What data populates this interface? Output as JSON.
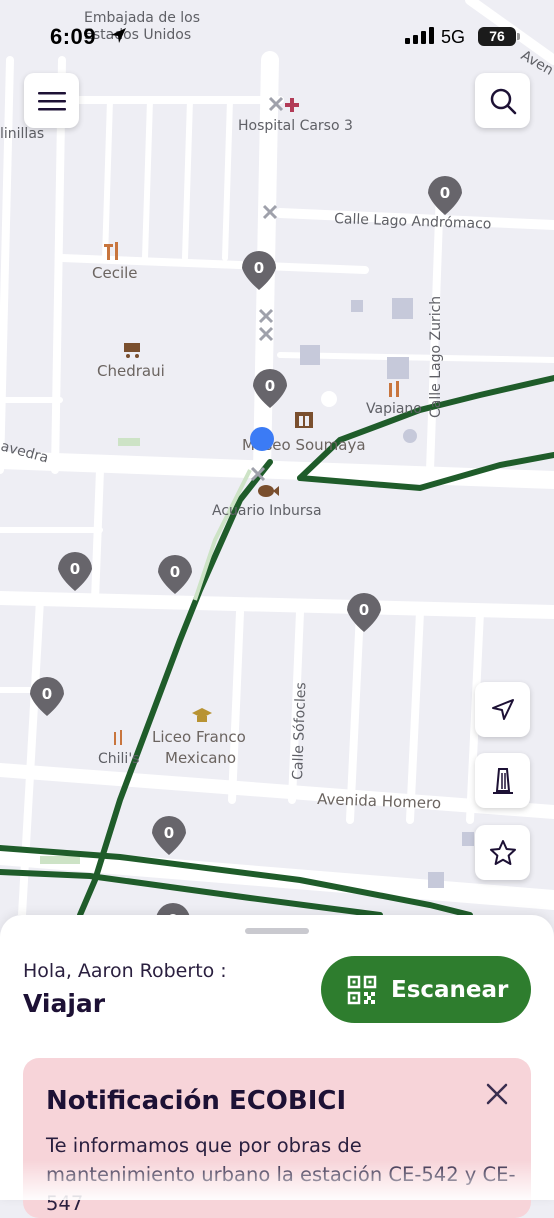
{
  "status_bar": {
    "time": "6:09",
    "network": "5G",
    "battery": "76"
  },
  "map": {
    "labels": {
      "embassy_1": "Embajada de los",
      "embassy_2": "Estados Unidos",
      "hospital": "Hospital Carso 3",
      "calle_lago_andromaco": "Calle Lago Andrómaco",
      "cecile": "Cecile",
      "chedraui": "Chedraui",
      "calle_lago_zurich": "Calle Lago Zurich",
      "vapiano": "Vapiano",
      "museo_soumaya": "Museo Soumaya",
      "acuario_inbursa": "Acuario Inbursa",
      "saavedra": "avedra",
      "linillas": "linillas",
      "avenida_top": "Aven",
      "calle_sofocles": "Calle Sófocles",
      "liceo_1": "Liceo Franco",
      "liceo_2": "Mexicano",
      "chilis": "Chili's",
      "avenida_homero": "Avenida Homero"
    },
    "station_count": "0",
    "colors": {
      "route": "#1f5c2a",
      "station_pin": "#67656b",
      "user_dot": "#3b7bf5",
      "road": "#ffffff",
      "background": "#eeeef4"
    }
  },
  "controls": {
    "menu_icon": "hamburger-menu-icon",
    "search_icon": "search-icon",
    "locate_icon": "navigation-arrow-icon",
    "monument_icon": "monument-icon",
    "favorites_icon": "star-icon"
  },
  "sheet": {
    "greeting": "Hola, Aaron Roberto :",
    "title": "Viajar",
    "scan_label": "Escanear",
    "scan_color": "#2e7d2e",
    "notification": {
      "title": "Notificación ECOBICI",
      "body": "Te informamos que por obras de mantenimiento urbano la estación CE-542 y CE-547",
      "background": "#f7d4d9"
    }
  }
}
